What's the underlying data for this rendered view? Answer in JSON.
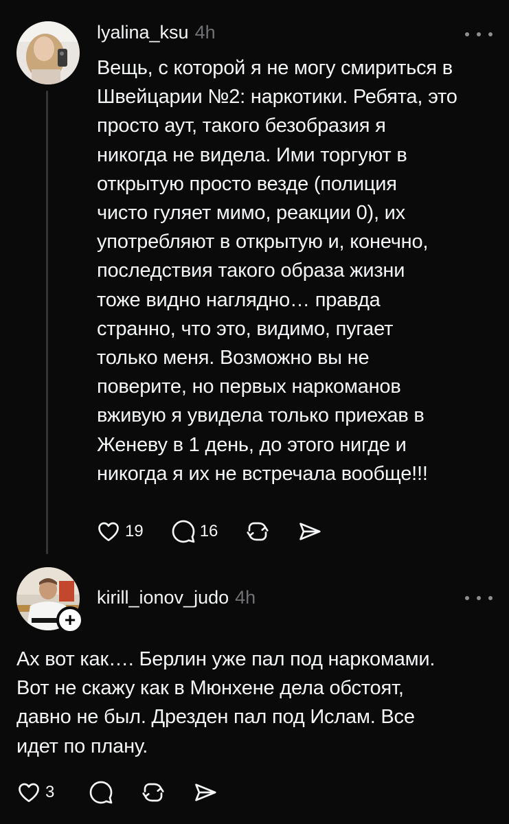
{
  "post": {
    "username": "lyalina_ksu",
    "time": "4h",
    "text": "Вещь, с которой я не могу смириться в\nШвейцарии №2: наркотики. Ребята, это\nпросто аут, такого безобразия я\nникогда не видела. Ими торгуют в\nоткрытую просто везде (полиция\nчисто гуляет мимо, реакции 0), их\nупотребляют в открытую и, конечно,\nпоследствия такого образа жизни\nтоже видно наглядно… правда\nстранно, что это, видимо, пугает\nтолько меня. Возможно вы не\nповерите, но первых наркоманов\nвживую я увидела только приехав в\nЖеневу в 1 день, до этого нигде и\nникогда я их не встречала вообще!!!",
    "likes": "19",
    "comments": "16",
    "avatar_icon": "user-photo-avatar"
  },
  "reply": {
    "username": "kirill_ionov_judo",
    "time": "4h",
    "text": "Ах вот как…. Берлин уже пал под наркомами.\nВот не скажу как в Мюнхене дела обстоят,\nдавно не был.  Дрезден пал под Ислам.  Все\nидет по плану.",
    "likes": "3",
    "follow_symbol": "+",
    "avatar_icon": "user-photo-avatar"
  },
  "icons": {
    "like": "heart-icon",
    "comment": "comment-icon",
    "repost": "repost-icon",
    "share": "send-icon",
    "more": "more-options-icon"
  },
  "colors": {
    "background": "#0a0a0a",
    "text": "#f3f5f7",
    "secondary": "#6f7175",
    "thread_line": "#333638"
  }
}
